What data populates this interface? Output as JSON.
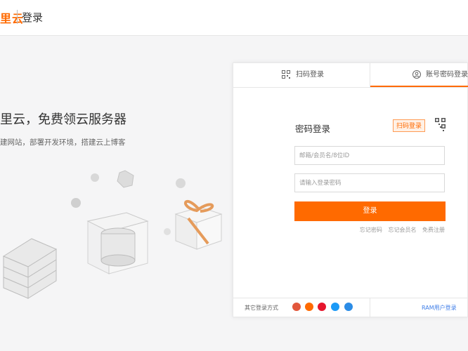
{
  "header": {
    "logo_text": "里云",
    "title": "登录"
  },
  "promo": {
    "title": "里云，免费领云服务器",
    "subtitle": "建网站，部署开发环境，搭建云上博客"
  },
  "tabs": [
    {
      "label": "扫码登录",
      "icon": "qr-code-icon",
      "active": false
    },
    {
      "label": "账号密码登录",
      "icon": "user-icon",
      "active": true
    }
  ],
  "form": {
    "title": "密码登录",
    "qr_badge": "扫码登录",
    "username_placeholder": "邮箱/会员名/8位ID",
    "password_placeholder": "请输入登录密码",
    "submit_label": "登录",
    "links": [
      "忘记密码",
      "忘记会员名",
      "免费注册"
    ]
  },
  "footer": {
    "other_label": "其它登录方式",
    "social_icons": [
      "weibo-icon",
      "taobao-icon",
      "weibo-red-icon",
      "alipay-icon",
      "dingtalk-icon"
    ],
    "ram_link": "RAM用户登录"
  },
  "colors": {
    "accent": "#ff6a00",
    "link": "#3f7ee8"
  }
}
